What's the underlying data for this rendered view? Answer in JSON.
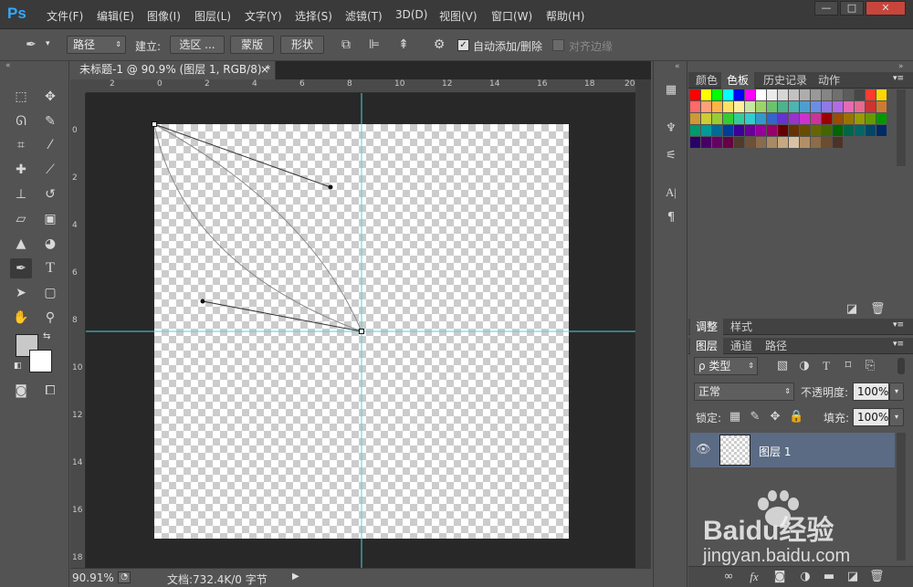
{
  "app": {
    "logo": "Ps"
  },
  "menu": [
    "文件(F)",
    "编辑(E)",
    "图像(I)",
    "图层(L)",
    "文字(Y)",
    "选择(S)",
    "滤镜(T)",
    "3D(D)",
    "视图(V)",
    "窗口(W)",
    "帮助(H)"
  ],
  "window_controls": {
    "minimize": "—",
    "maximize": "□",
    "close": "✕"
  },
  "options": {
    "mode": "路径",
    "build_label": "建立:",
    "selection_btn": "选区 ...",
    "mask_btn": "蒙版",
    "shape_btn": "形状",
    "auto_add_delete": "自动添加/删除",
    "align_edges": "对齐边缘"
  },
  "document": {
    "tab_title": "未标题-1 @ 90.9% (图层 1, RGB/8) *",
    "close": "×",
    "ruler_top": [
      "2",
      "0",
      "2",
      "4",
      "6",
      "8",
      "10",
      "12",
      "14",
      "16",
      "18",
      "20"
    ],
    "ruler_left": [
      "0",
      "2",
      "4",
      "6",
      "8",
      "10",
      "12",
      "14",
      "16",
      "18"
    ]
  },
  "status": {
    "zoom": "90.91%",
    "doc_info": "文档:732.4K/0 字节"
  },
  "swatch_panel": {
    "tabs": [
      "颜色",
      "色板",
      "历史记录",
      "动作"
    ],
    "active": 1
  },
  "swatch_colors": [
    "#ff0000",
    "#ffff00",
    "#00ff00",
    "#00ffff",
    "#0000ff",
    "#ff00ff",
    "#ffffff",
    "#ebebeb",
    "#d6d6d6",
    "#c2c2c2",
    "#adadad",
    "#999999",
    "#858585",
    "#707070",
    "#5c5c5c",
    "#474747",
    "#ff3b30",
    "#ffd700",
    "#ff6a6a",
    "#ffa07a",
    "#ffb347",
    "#ffe066",
    "#fff099",
    "#c8e6a0",
    "#9ed36a",
    "#6cc26c",
    "#4db38c",
    "#4db3b3",
    "#4d9ecf",
    "#6a8ee6",
    "#8f7ae6",
    "#b36ae6",
    "#e66ab3",
    "#e66a8f",
    "#cc3333",
    "#cc7a33",
    "#cc9933",
    "#cccc33",
    "#99cc33",
    "#33cc33",
    "#33cc99",
    "#33cccc",
    "#3399cc",
    "#3366cc",
    "#6633cc",
    "#9933cc",
    "#cc33cc",
    "#cc3399",
    "#990000",
    "#994d00",
    "#997300",
    "#999900",
    "#669900",
    "#009900",
    "#00996b",
    "#009999",
    "#006b99",
    "#003d99",
    "#3d0099",
    "#6b0099",
    "#990099",
    "#99006b",
    "#660000",
    "#663300",
    "#664d00",
    "#666600",
    "#446600",
    "#006600",
    "#006647",
    "#006666",
    "#004766",
    "#002966",
    "#290066",
    "#470066",
    "#660066",
    "#660047",
    "#4d3b2b",
    "#6b5239",
    "#8a6b4d",
    "#a88a66",
    "#c7a880",
    "#d9c2a3",
    "#b38f66",
    "#8f6b47",
    "#6b4d33",
    "#4d3326"
  ],
  "adjust_panel": {
    "tabs": [
      "调整",
      "样式"
    ]
  },
  "layers_panel": {
    "tabs": [
      "图层",
      "通道",
      "路径"
    ],
    "filter": "ρ 类型",
    "blend_mode": "正常",
    "opacity_label": "不透明度:",
    "opacity": "100%",
    "lock_label": "锁定:",
    "fill_label": "填充:",
    "fill": "100%",
    "layers": [
      {
        "name": "图层 1"
      }
    ]
  },
  "watermark": {
    "brand": "Baidu经验",
    "url": "jingyan.baidu.com"
  },
  "colors": {
    "accent_cyan": "#4fd2e0",
    "layer_selected": "#5b6b84"
  }
}
